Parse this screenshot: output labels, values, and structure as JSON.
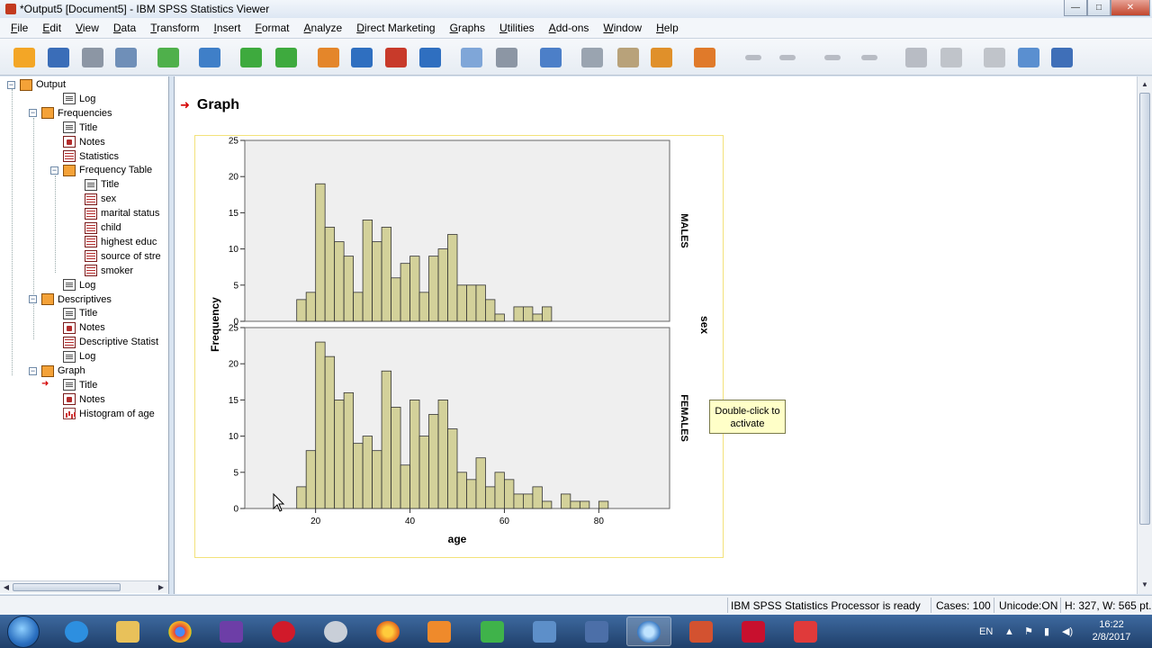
{
  "window": {
    "title": "*Output5 [Document5] - IBM SPSS Statistics Viewer",
    "controls": {
      "minimize": "—",
      "maximize": "□",
      "close": "✕"
    }
  },
  "menubar": [
    "File",
    "Edit",
    "View",
    "Data",
    "Transform",
    "Insert",
    "Format",
    "Analyze",
    "Direct Marketing",
    "Graphs",
    "Utilities",
    "Add-ons",
    "Window",
    "Help"
  ],
  "toolbar": {
    "icons": [
      "open-icon",
      "save-icon",
      "print-icon",
      "print-preview-icon",
      "export-icon",
      "recall-dialog-icon",
      "undo-icon",
      "redo-icon",
      "goto-data-icon",
      "goto-case-icon",
      "goto-variable-icon",
      "variables-icon",
      "designate-window-icon",
      "show-all-icon",
      "hide-icon",
      "pivot-icon",
      "insert-heading-icon",
      "insert-title-icon",
      "insert-text-icon",
      "insert-chart-icon",
      "back-icon",
      "forward-icon",
      "expand-icon",
      "collapse-icon",
      "show-icon",
      "hide-output-icon",
      "insert-new-heading-icon",
      "insert-new-title-icon",
      "insert-new-text-icon"
    ]
  },
  "outline": {
    "nodes": [
      {
        "label": "Output",
        "icon": "book",
        "expander": "⊟",
        "level": 0
      },
      {
        "label": "Log",
        "icon": "doc",
        "level": 2
      },
      {
        "label": "Frequencies",
        "icon": "book",
        "expander": "⊟",
        "level": 1
      },
      {
        "label": "Title",
        "icon": "doc",
        "level": 2
      },
      {
        "label": "Notes",
        "icon": "note",
        "level": 2
      },
      {
        "label": "Statistics",
        "icon": "tbl",
        "level": 2
      },
      {
        "label": "Frequency Table",
        "icon": "book",
        "expander": "⊟",
        "level": 2
      },
      {
        "label": "Title",
        "icon": "doc",
        "level": 3
      },
      {
        "label": "sex",
        "icon": "tbl",
        "level": 3
      },
      {
        "label": "marital status",
        "icon": "tbl",
        "level": 3
      },
      {
        "label": "child",
        "icon": "tbl",
        "level": 3
      },
      {
        "label": "highest educ",
        "icon": "tbl",
        "level": 3
      },
      {
        "label": "source of stre",
        "icon": "tbl",
        "level": 3
      },
      {
        "label": "smoker",
        "icon": "tbl",
        "level": 3
      },
      {
        "label": "Log",
        "icon": "doc",
        "level": 2
      },
      {
        "label": "Descriptives",
        "icon": "book",
        "expander": "⊟",
        "level": 1
      },
      {
        "label": "Title",
        "icon": "doc",
        "level": 2
      },
      {
        "label": "Notes",
        "icon": "note",
        "level": 2
      },
      {
        "label": "Descriptive Statist",
        "icon": "tbl",
        "level": 2
      },
      {
        "label": "Log",
        "icon": "doc",
        "level": 2
      },
      {
        "label": "Graph",
        "icon": "book",
        "expander": "⊟",
        "level": 1
      },
      {
        "label": "Title",
        "icon": "doc",
        "level": 2,
        "selected": true
      },
      {
        "label": "Notes",
        "icon": "note",
        "level": 2
      },
      {
        "label": "Histogram of age",
        "icon": "chart",
        "level": 2
      }
    ]
  },
  "content": {
    "heading": "Graph",
    "tooltip": "Double-click to activate"
  },
  "chart_data": {
    "type": "bar",
    "subtype": "paneled-histogram",
    "xlabel": "age",
    "ylabel": "Frequency",
    "panel_variable": "sex",
    "xlim": [
      5,
      95
    ],
    "ylim": [
      0,
      25
    ],
    "x_ticks": [
      20,
      40,
      60,
      80
    ],
    "y_ticks": [
      0,
      5,
      10,
      15,
      20,
      25
    ],
    "bin_width": 2,
    "bar_color": "#d3d19a",
    "panel_background": "#efefef",
    "grid": false,
    "series": [
      {
        "name": "MALES",
        "bins": [
          {
            "x": 17,
            "y": 3
          },
          {
            "x": 19,
            "y": 4
          },
          {
            "x": 21,
            "y": 19
          },
          {
            "x": 23,
            "y": 13
          },
          {
            "x": 25,
            "y": 11
          },
          {
            "x": 27,
            "y": 9
          },
          {
            "x": 29,
            "y": 4
          },
          {
            "x": 31,
            "y": 14
          },
          {
            "x": 33,
            "y": 11
          },
          {
            "x": 35,
            "y": 13
          },
          {
            "x": 37,
            "y": 6
          },
          {
            "x": 39,
            "y": 8
          },
          {
            "x": 41,
            "y": 9
          },
          {
            "x": 43,
            "y": 4
          },
          {
            "x": 45,
            "y": 9
          },
          {
            "x": 47,
            "y": 10
          },
          {
            "x": 49,
            "y": 12
          },
          {
            "x": 51,
            "y": 5
          },
          {
            "x": 53,
            "y": 5
          },
          {
            "x": 55,
            "y": 5
          },
          {
            "x": 57,
            "y": 3
          },
          {
            "x": 59,
            "y": 1
          },
          {
            "x": 61,
            "y": 0
          },
          {
            "x": 63,
            "y": 2
          },
          {
            "x": 65,
            "y": 2
          },
          {
            "x": 67,
            "y": 1
          },
          {
            "x": 69,
            "y": 2
          }
        ]
      },
      {
        "name": "FEMALES",
        "bins": [
          {
            "x": 17,
            "y": 3
          },
          {
            "x": 19,
            "y": 8
          },
          {
            "x": 21,
            "y": 23
          },
          {
            "x": 23,
            "y": 21
          },
          {
            "x": 25,
            "y": 15
          },
          {
            "x": 27,
            "y": 16
          },
          {
            "x": 29,
            "y": 9
          },
          {
            "x": 31,
            "y": 10
          },
          {
            "x": 33,
            "y": 8
          },
          {
            "x": 35,
            "y": 19
          },
          {
            "x": 37,
            "y": 14
          },
          {
            "x": 39,
            "y": 6
          },
          {
            "x": 41,
            "y": 15
          },
          {
            "x": 43,
            "y": 10
          },
          {
            "x": 45,
            "y": 13
          },
          {
            "x": 47,
            "y": 15
          },
          {
            "x": 49,
            "y": 11
          },
          {
            "x": 51,
            "y": 5
          },
          {
            "x": 53,
            "y": 4
          },
          {
            "x": 55,
            "y": 7
          },
          {
            "x": 57,
            "y": 3
          },
          {
            "x": 59,
            "y": 5
          },
          {
            "x": 61,
            "y": 4
          },
          {
            "x": 63,
            "y": 2
          },
          {
            "x": 65,
            "y": 2
          },
          {
            "x": 67,
            "y": 3
          },
          {
            "x": 69,
            "y": 1
          },
          {
            "x": 71,
            "y": 0
          },
          {
            "x": 73,
            "y": 2
          },
          {
            "x": 75,
            "y": 1
          },
          {
            "x": 77,
            "y": 1
          },
          {
            "x": 79,
            "y": 0
          },
          {
            "x": 81,
            "y": 1
          }
        ]
      }
    ]
  },
  "statusbar": {
    "processor": "IBM SPSS Statistics Processor is ready",
    "cases": "Cases: 100",
    "unicode": "Unicode:ON",
    "dimensions": "H: 327, W: 565 pt."
  },
  "taskbar": {
    "language": "EN",
    "time": "16:22",
    "date": "2/8/2017"
  }
}
